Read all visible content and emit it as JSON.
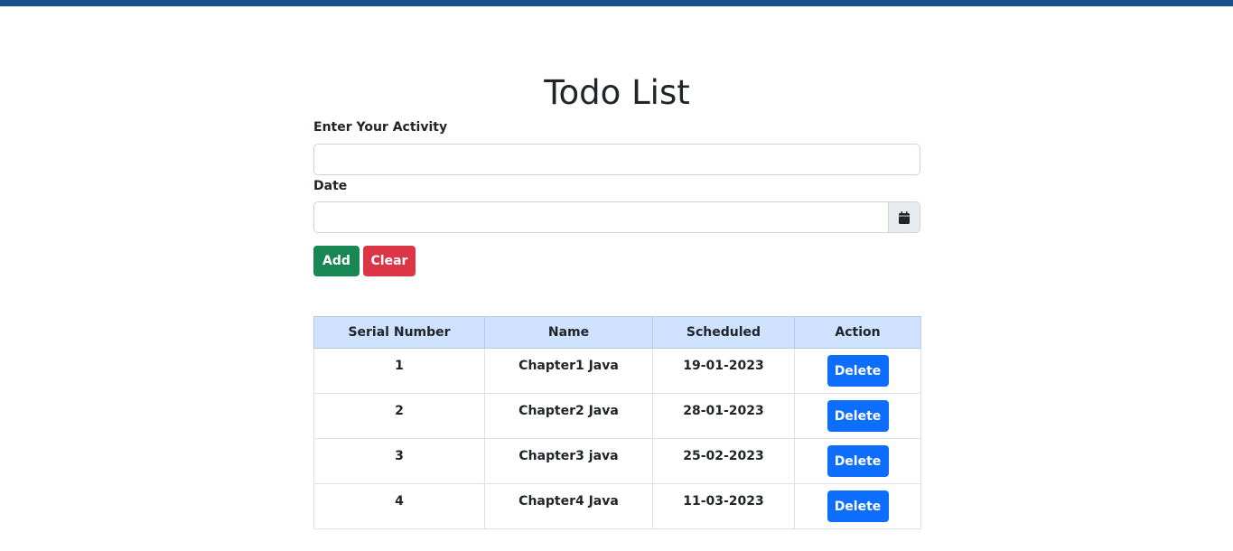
{
  "page": {
    "title": "Todo List"
  },
  "form": {
    "activity_label": "Enter Your Activity",
    "activity_value": "",
    "date_label": "Date",
    "date_value": "",
    "calendar_icon": "calendar-icon",
    "add_label": "Add",
    "clear_label": "Clear"
  },
  "colors": {
    "top_strip": "#1a4f8e",
    "add_button": "#198754",
    "clear_button": "#dc3545",
    "delete_button": "#0d6efd",
    "table_header": "#cfe2ff"
  },
  "table": {
    "headers": [
      "Serial Number",
      "Name",
      "Scheduled",
      "Action"
    ],
    "rows": [
      {
        "serial": "1",
        "name": "Chapter1 Java",
        "scheduled": "19-01-2023",
        "action": "Delete"
      },
      {
        "serial": "2",
        "name": "Chapter2 Java",
        "scheduled": "28-01-2023",
        "action": "Delete"
      },
      {
        "serial": "3",
        "name": "Chapter3 java",
        "scheduled": "25-02-2023",
        "action": "Delete"
      },
      {
        "serial": "4",
        "name": "Chapter4 Java",
        "scheduled": "11-03-2023",
        "action": "Delete"
      }
    ]
  }
}
